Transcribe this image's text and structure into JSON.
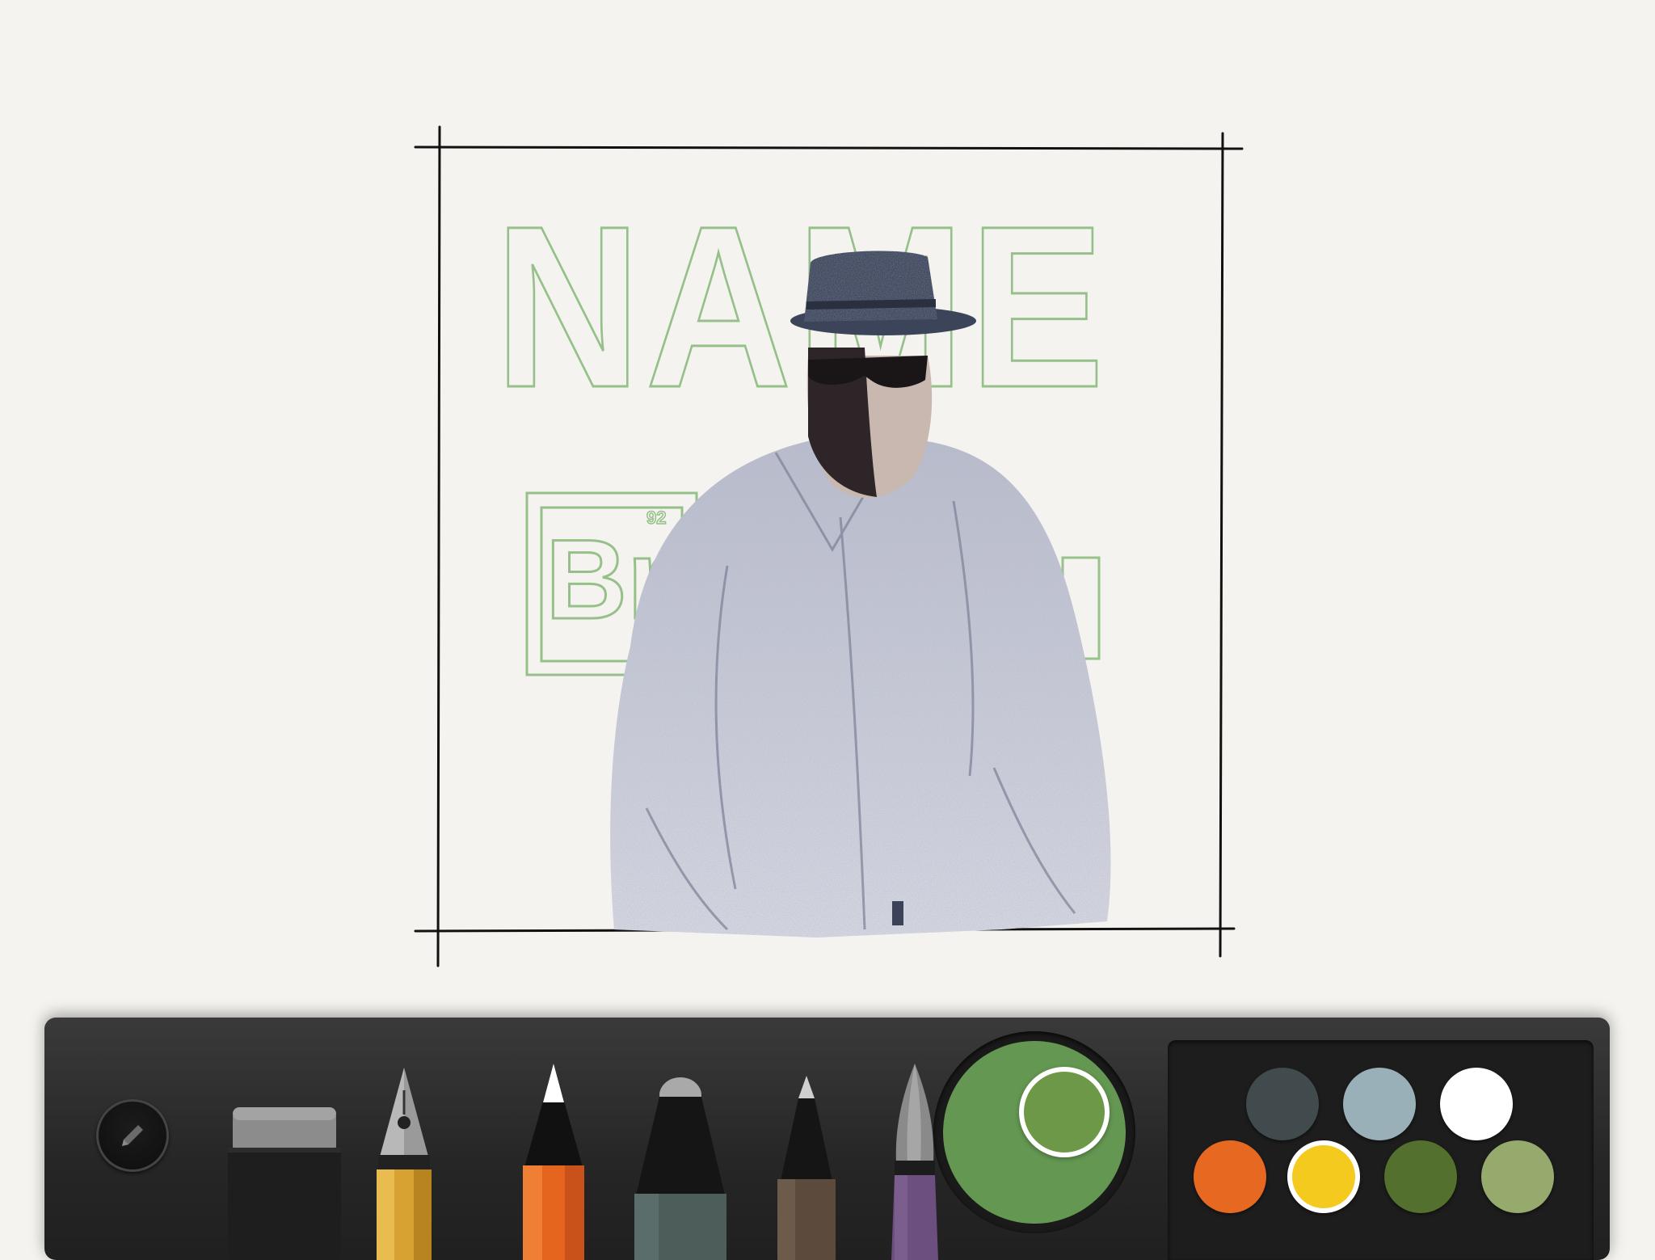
{
  "app": {
    "screen": "sketch-canvas"
  },
  "artwork": {
    "headline_text": "NAME",
    "sub_text": "Br",
    "small_mark": "92",
    "line_color": "#111111",
    "sketch_green": "#86b878",
    "hat_color": "#3b4459",
    "shirt_shade": "#8d92a6"
  },
  "toolbar": {
    "menu_icon": "pencil-icon",
    "tools": [
      {
        "id": "eraser",
        "icon": "eraser-icon"
      },
      {
        "id": "fountain-pen",
        "icon": "fountain-pen-icon"
      },
      {
        "id": "pencil",
        "icon": "pencil-icon",
        "selected": true
      },
      {
        "id": "marker",
        "icon": "marker-icon"
      },
      {
        "id": "fine-pen",
        "icon": "fine-pen-icon"
      },
      {
        "id": "brush",
        "icon": "brush-icon"
      }
    ],
    "color_wheel": {
      "current_color": "#649752",
      "selected_color": "#6c9848"
    },
    "swatches": [
      {
        "color": "#414a4d",
        "selected": false
      },
      {
        "color": "#9ab0b9",
        "selected": false
      },
      {
        "color": "#ffffff",
        "selected": false
      },
      {
        "color": "#e76921",
        "selected": false
      },
      {
        "color": "#f4ca1f",
        "selected": true
      },
      {
        "color": "#53702f",
        "selected": false
      },
      {
        "color": "#97aa6e",
        "selected": false
      }
    ]
  }
}
